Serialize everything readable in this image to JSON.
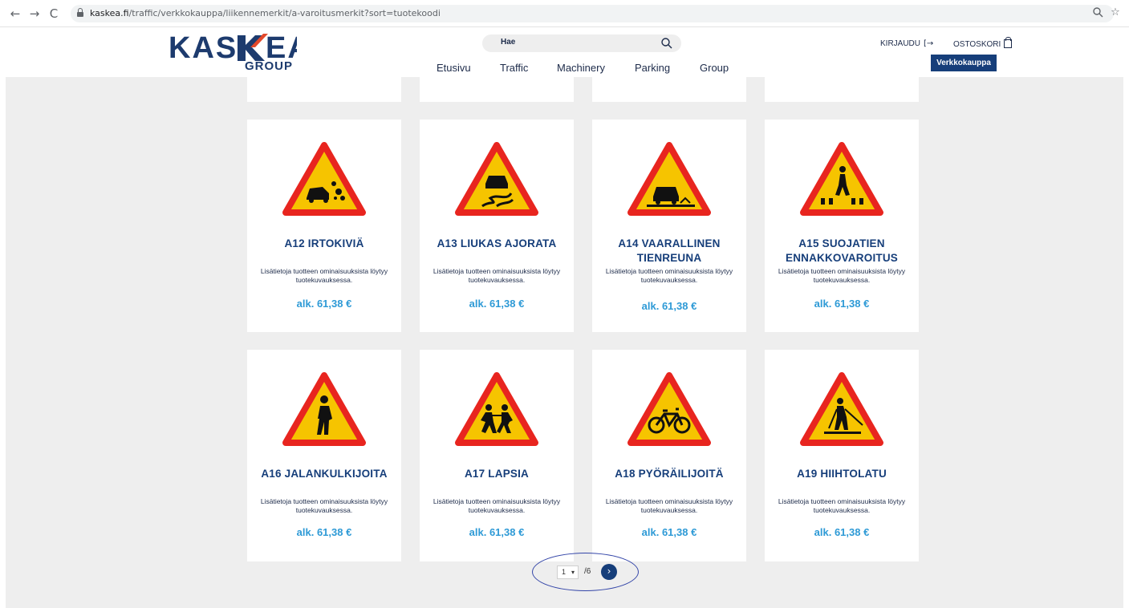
{
  "browser": {
    "url_domain": "kaskea.fi",
    "url_path": "/traffic/verkkokauppa/liikennemerkit/a-varoitusmerkit?sort=tuotekoodi",
    "back_icon": "←",
    "forward_icon": "→",
    "reload_icon": "C",
    "zoom_icon": "🔍",
    "bookmark_icon": "☆"
  },
  "header": {
    "logo_text": "KASKEA",
    "logo_sub": "GROUP",
    "search_text": "Hae",
    "nav": [
      "Etusivu",
      "Traffic",
      "Machinery",
      "Parking",
      "Group"
    ],
    "login_label": "KIRJAUDU",
    "login_icon": "[→",
    "cart_label": "OSTOSKORI",
    "shop_button": "Verkkokauppa",
    "colors": {
      "brand_blue": "#163e7a",
      "accent_red": "#e3492b",
      "price_blue": "#2e9ad6"
    }
  },
  "products": [
    {
      "title": "A12 IRTOKIVIÄ",
      "desc": "Lisätietoja tuotteen ominaisuuksista löytyy tuotekuvauksessa.",
      "price": "alk. 61,38 €",
      "icon": "loose-chippings-sign-icon"
    },
    {
      "title": "A13 LIUKAS AJORATA",
      "desc": "Lisätietoja tuotteen ominaisuuksista löytyy tuotekuvauksessa.",
      "price": "alk. 61,38 €",
      "icon": "slippery-road-sign-icon"
    },
    {
      "title": "A14 VAARALLINEN TIENREUNA",
      "desc": "Lisätietoja tuotteen ominaisuuksista löytyy tuotekuvauksessa.",
      "price": "alk. 61,38 €",
      "icon": "dangerous-roadside-sign-icon"
    },
    {
      "title": "A15 SUOJATIEN ENNAKKOVAROITUS",
      "desc": "Lisätietoja tuotteen ominaisuuksista löytyy tuotekuvauksessa.",
      "price": "alk. 61,38 €",
      "icon": "pedestrian-crossing-sign-icon"
    },
    {
      "title": "A16 JALANKULKIJOITA",
      "desc": "Lisätietoja tuotteen ominaisuuksista löytyy tuotekuvauksessa.",
      "price": "alk. 61,38 €",
      "icon": "pedestrians-sign-icon"
    },
    {
      "title": "A17 LAPSIA",
      "desc": "Lisätietoja tuotteen ominaisuuksista löytyy tuotekuvauksessa.",
      "price": "alk. 61,38 €",
      "icon": "children-sign-icon"
    },
    {
      "title": "A18 PYÖRÄILIJOITÄ",
      "desc": "Lisätietoja tuotteen ominaisuuksista löytyy tuotekuvauksessa.",
      "price": "alk. 61,38 €",
      "icon": "cyclists-sign-icon"
    },
    {
      "title": "A19 HIIHTOLATU",
      "desc": "Lisätietoja tuotteen ominaisuuksista löytyy tuotekuvauksessa.",
      "price": "alk. 61,38 €",
      "icon": "ski-trail-sign-icon"
    }
  ],
  "pagination": {
    "current_page": "1",
    "total_label": "/6",
    "dropdown_icon": "▾",
    "next_icon": "›"
  }
}
